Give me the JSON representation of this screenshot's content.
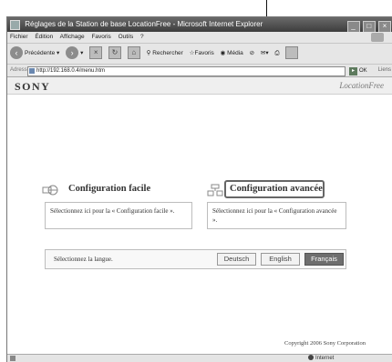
{
  "window": {
    "title": "Réglages de la Station de base LocationFree - Microsoft Internet Explorer",
    "controls": [
      "_",
      "□",
      "×"
    ]
  },
  "menubar": {
    "items": [
      "Fichier",
      "Édition",
      "Affichage",
      "Favoris",
      "Outils",
      "?"
    ]
  },
  "toolbar": {
    "back_label": "Précédente",
    "search_label": "Rechercher",
    "favorites_label": "Favoris",
    "media_label": "Média"
  },
  "addressbar": {
    "label": "Adresse",
    "url": "http://192.168.0.4/menu.htm",
    "go_label": "OK",
    "links_label": "Liens"
  },
  "page": {
    "brand": "SONY",
    "product_logo": "LocationFree",
    "easy_setup": {
      "title": "Configuration facile",
      "description": "Sélectionnez ici pour la « Configuration facile »."
    },
    "advanced_setup": {
      "title": "Configuration avancée",
      "description": "Sélectionnez ici pour la « Configuration avancée »."
    },
    "language": {
      "label": "Sélectionnez la langue.",
      "options": [
        "Deutsch",
        "English",
        "Français"
      ],
      "selected": "Français"
    },
    "copyright": "Copyright 2006 Sony Corporation"
  },
  "statusbar": {
    "zone": "Internet"
  },
  "colors": {
    "selected_language_bg": "#6e6e6e",
    "titlebar": "#4a4a4a"
  }
}
